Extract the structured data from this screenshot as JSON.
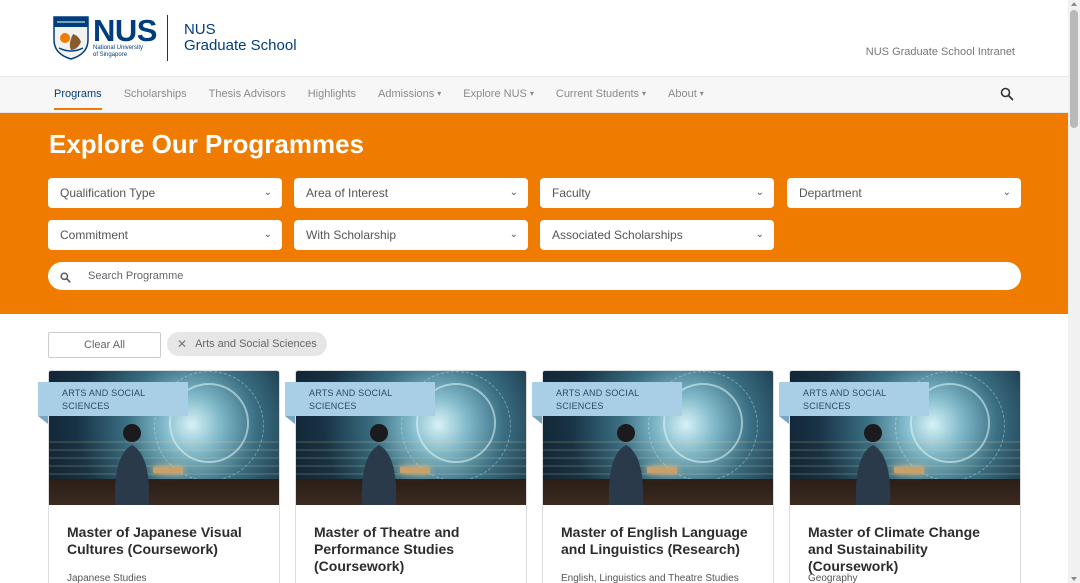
{
  "header": {
    "logo": {
      "wordmark": "NUS",
      "subtitle_line1": "National University",
      "subtitle_line2": "of Singapore"
    },
    "site_title_line1": "NUS",
    "site_title_line2": "Graduate School",
    "intranet_link": "NUS Graduate School Intranet"
  },
  "nav": {
    "items": [
      {
        "label": "Programs",
        "active": true,
        "dropdown": false
      },
      {
        "label": "Scholarships",
        "active": false,
        "dropdown": false
      },
      {
        "label": "Thesis Advisors",
        "active": false,
        "dropdown": false
      },
      {
        "label": "Highlights",
        "active": false,
        "dropdown": false
      },
      {
        "label": "Admissions",
        "active": false,
        "dropdown": true
      },
      {
        "label": "Explore NUS",
        "active": false,
        "dropdown": true
      },
      {
        "label": "Current Students",
        "active": false,
        "dropdown": true
      },
      {
        "label": "About",
        "active": false,
        "dropdown": true
      }
    ],
    "search_icon": "search-icon"
  },
  "hero": {
    "title": "Explore Our Programmes",
    "filters": [
      "Qualification Type",
      "Area of Interest",
      "Faculty",
      "Department",
      "Commitment",
      "With Scholarship",
      "Associated Scholarships"
    ],
    "search_placeholder": "Search Programme"
  },
  "active_filters": {
    "clear_all": "Clear All",
    "chips": [
      "Arts and Social Sciences"
    ]
  },
  "cards": [
    {
      "tag_line1": "ARTS AND SOCIAL",
      "tag_line2": "SCIENCES",
      "title": "Master of Japanese Visual Cultures (Coursework)",
      "department": "Japanese Studies"
    },
    {
      "tag_line1": "ARTS AND SOCIAL",
      "tag_line2": "SCIENCES",
      "title": "Master of Theatre and Performance Studies (Coursework)",
      "department": ""
    },
    {
      "tag_line1": "ARTS AND SOCIAL",
      "tag_line2": "SCIENCES",
      "title": "Master of English Language and Linguistics (Research)",
      "department": "English, Linguistics and Theatre Studies"
    },
    {
      "tag_line1": "ARTS AND SOCIAL",
      "tag_line2": "SCIENCES",
      "title": "Master of Climate Change and Sustainability (Coursework)",
      "department": "Geography"
    }
  ],
  "colors": {
    "brand_blue": "#003d7c",
    "brand_orange": "#ef7c00",
    "tag_blue": "#a9cfe6"
  }
}
